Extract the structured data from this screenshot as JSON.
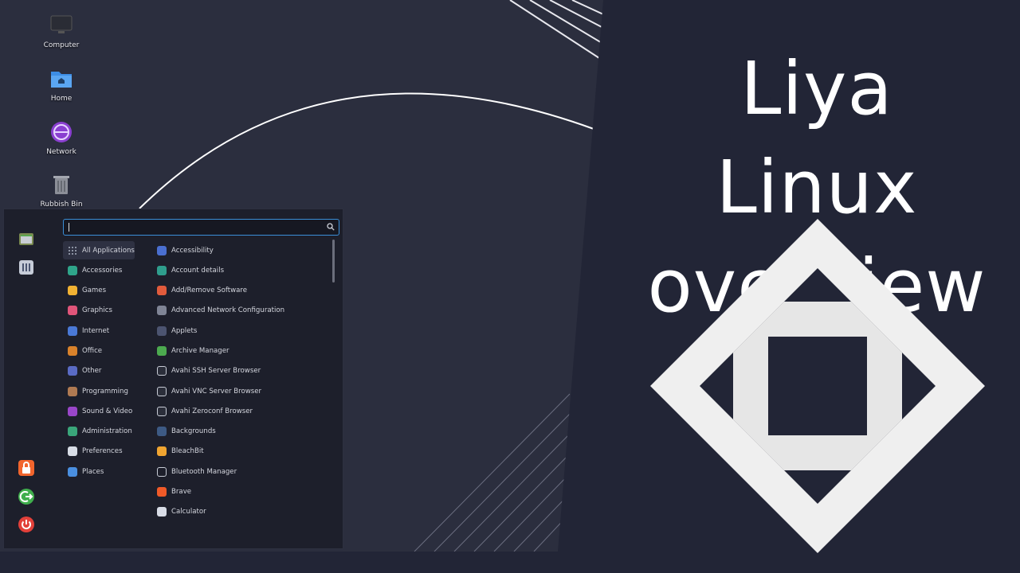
{
  "title": {
    "line1": "Liya Linux",
    "line2": "overview"
  },
  "desktop_icons": [
    {
      "label": "Computer",
      "icon": "computer-icon"
    },
    {
      "label": "Home",
      "icon": "home-folder-icon"
    },
    {
      "label": "Network",
      "icon": "network-icon"
    },
    {
      "label": "Rubbish Bin",
      "icon": "trash-icon"
    }
  ],
  "menu": {
    "search": {
      "value": "",
      "placeholder": ""
    },
    "categories": [
      {
        "label": "All Applications",
        "icon": "grid-icon",
        "color": "#9aa0b0",
        "selected": true
      },
      {
        "label": "Accessories",
        "icon": "accessories-icon",
        "color": "#2fa58a"
      },
      {
        "label": "Games",
        "icon": "games-icon",
        "color": "#f2b233"
      },
      {
        "label": "Graphics",
        "icon": "graphics-icon",
        "color": "#e0557a"
      },
      {
        "label": "Internet",
        "icon": "internet-icon",
        "color": "#4a79d6"
      },
      {
        "label": "Office",
        "icon": "office-icon",
        "color": "#d9822b"
      },
      {
        "label": "Other",
        "icon": "other-icon",
        "color": "#5a6bc4"
      },
      {
        "label": "Programming",
        "icon": "programming-icon",
        "color": "#b07a52"
      },
      {
        "label": "Sound & Video",
        "icon": "sound-video-icon",
        "color": "#9a46c9"
      },
      {
        "label": "Administration",
        "icon": "administration-icon",
        "color": "#3aa67a"
      },
      {
        "label": "Preferences",
        "icon": "preferences-icon",
        "color": "#d8dde6"
      },
      {
        "label": "Places",
        "icon": "places-icon",
        "color": "#4a8fe0"
      }
    ],
    "apps": [
      {
        "label": "Accessibility",
        "icon": "accessibility-icon",
        "color": "#4a6fd0"
      },
      {
        "label": "Account details",
        "icon": "account-icon",
        "color": "#2f9e8d"
      },
      {
        "label": "Add/Remove Software",
        "icon": "software-icon",
        "color": "#e15b3c"
      },
      {
        "label": "Advanced Network Configuration",
        "icon": "network-config-icon",
        "color": "#7f8495"
      },
      {
        "label": "Applets",
        "icon": "applets-icon",
        "color": "#4c5470"
      },
      {
        "label": "Archive Manager",
        "icon": "archive-icon",
        "color": "#4caa4f"
      },
      {
        "label": "Avahi SSH Server Browser",
        "icon": "avahi-ssh-icon",
        "color": "#2b2e3a"
      },
      {
        "label": "Avahi VNC Server Browser",
        "icon": "avahi-vnc-icon",
        "color": "#2b2e3a"
      },
      {
        "label": "Avahi Zeroconf Browser",
        "icon": "avahi-zeroconf-icon",
        "color": "#2b2e3a"
      },
      {
        "label": "Backgrounds",
        "icon": "backgrounds-icon",
        "color": "#3d5a84"
      },
      {
        "label": "BleachBit",
        "icon": "bleachbit-icon",
        "color": "#f0a531"
      },
      {
        "label": "Bluetooth Manager",
        "icon": "bluetooth-icon",
        "color": "#1d1f2b"
      },
      {
        "label": "Brave",
        "icon": "brave-icon",
        "color": "#f05a28"
      },
      {
        "label": "Calculator",
        "icon": "calculator-icon",
        "color": "#d8dce6"
      }
    ],
    "side_top": [
      {
        "icon": "files-icon",
        "color": "#7a8a50"
      },
      {
        "icon": "settings-panel-icon",
        "color": "#c6ccd8"
      }
    ],
    "side_bottom": [
      {
        "icon": "lock-icon",
        "color": "#f2652d"
      },
      {
        "icon": "logout-icon",
        "color": "#3fae4c"
      },
      {
        "icon": "power-icon",
        "color": "#e2403a"
      }
    ]
  },
  "taskbar": {
    "tray": [
      {
        "icon": "terminal-icon",
        "color": "#8a6e58"
      },
      {
        "icon": "file-manager-icon",
        "color": "#7c8c52"
      },
      {
        "icon": "brave-tray-icon",
        "color": "#f05a28"
      }
    ]
  },
  "colors": {
    "background": "#222536",
    "accent": "#3b8fd8",
    "logo": "#efefef"
  }
}
